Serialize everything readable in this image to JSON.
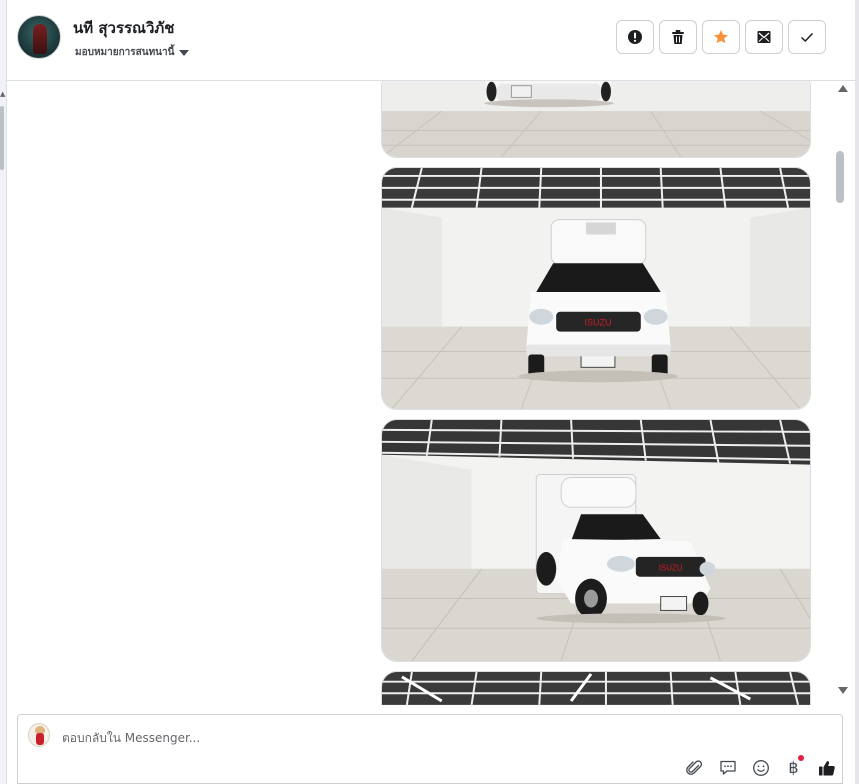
{
  "header": {
    "contact_name": "นที สุวรรณวิภัช",
    "assign_label": "มอบหมายการสนทนานี้",
    "actions": [
      {
        "name": "mark-spam-button",
        "icon": "exclamation-circle-icon"
      },
      {
        "name": "delete-button",
        "icon": "trash-icon"
      },
      {
        "name": "star-button",
        "icon": "star-icon",
        "color": "#f7923b"
      },
      {
        "name": "mark-unread-button",
        "icon": "envelope-icon"
      },
      {
        "name": "mark-done-button",
        "icon": "check-icon"
      }
    ]
  },
  "conversation": {
    "messages": [
      {
        "type": "image",
        "subject": "white Isuzu pickup truck with refrigerated box, front view (partial)"
      },
      {
        "type": "image",
        "subject": "white Isuzu pickup truck with refrigerated box, front view"
      },
      {
        "type": "image",
        "subject": "white Isuzu pickup truck with refrigerated box, three-quarter view"
      },
      {
        "type": "image",
        "subject": "showroom ceiling (partial)"
      }
    ]
  },
  "composer": {
    "placeholder": "ตอบกลับใน Messenger...",
    "tools": [
      "paperclip-icon",
      "speech-bubble-icon",
      "smiley-icon",
      "baht-icon",
      "thumbs-up-icon"
    ],
    "baht_symbol": "฿",
    "notification_color": "#e41e3f"
  },
  "colors": {
    "border": "#ccd0d5",
    "text": "#1c1e21",
    "accent_star": "#f7923b"
  }
}
